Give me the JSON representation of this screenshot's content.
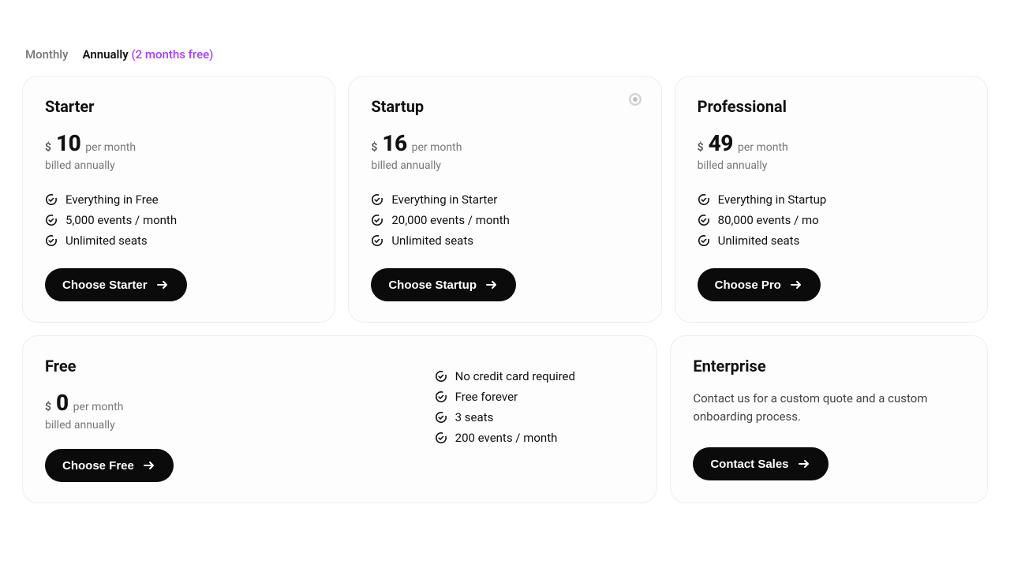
{
  "tabs": {
    "monthly": "Monthly",
    "annually": "Annually",
    "promo": "(2 months free)"
  },
  "currency": "$",
  "per": "per month",
  "billed": "billed annually",
  "plans": {
    "starter": {
      "name": "Starter",
      "price": "10",
      "features": [
        "Everything in Free",
        "5,000 events / month",
        "Unlimited seats"
      ],
      "cta": "Choose Starter"
    },
    "startup": {
      "name": "Startup",
      "price": "16",
      "features": [
        "Everything in Starter",
        "20,000 events / month",
        "Unlimited seats"
      ],
      "cta": "Choose Startup"
    },
    "professional": {
      "name": "Professional",
      "price": "49",
      "features": [
        "Everything in Startup",
        "80,000 events / mo",
        "Unlimited seats"
      ],
      "cta": "Choose Pro"
    },
    "free": {
      "name": "Free",
      "price": "0",
      "features": [
        "No credit card required",
        "Free forever",
        "3 seats",
        "200 events / month"
      ],
      "cta": "Choose Free"
    },
    "enterprise": {
      "name": "Enterprise",
      "desc": "Contact us for a custom quote and a custom onboarding process.",
      "cta": "Contact Sales"
    }
  }
}
